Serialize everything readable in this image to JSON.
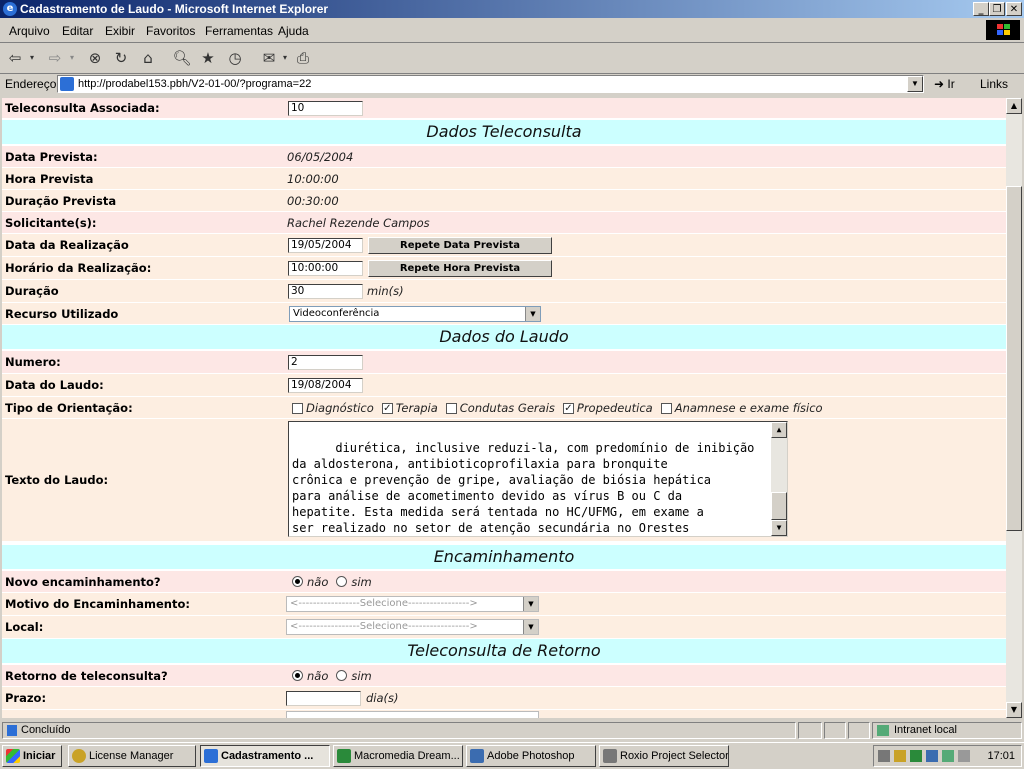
{
  "window": {
    "title": "Cadastramento de Laudo - Microsoft Internet Explorer"
  },
  "menu": [
    "Arquivo",
    "Editar",
    "Exibir",
    "Favoritos",
    "Ferramentas",
    "Ajuda"
  ],
  "address": {
    "label": "Endereço",
    "url": "http://prodabel153.pbh/V2-01-00/?programa=22",
    "go": "Ir",
    "links": "Links"
  },
  "form": {
    "teleconsulta_associada": {
      "label": "Teleconsulta Associada:",
      "value": "10"
    },
    "section_teleconsulta": "Dados Teleconsulta",
    "data_prevista": {
      "label": "Data Prevista:",
      "value": "06/05/2004"
    },
    "hora_prevista": {
      "label": "Hora Prevista",
      "value": "10:00:00"
    },
    "duracao_prevista": {
      "label": "Duração Prevista",
      "value": "00:30:00"
    },
    "solicitantes": {
      "label": "Solicitante(s):",
      "value": "Rachel Rezende Campos"
    },
    "data_realizacao": {
      "label": "Data da Realização",
      "value": "19/05/2004",
      "button": "Repete Data Prevista"
    },
    "horario_realizacao": {
      "label": "Horário da Realização:",
      "value": "10:00:00",
      "button": "Repete Hora Prevista"
    },
    "duracao": {
      "label": "Duração",
      "value": "30",
      "unit": "min(s)"
    },
    "recurso": {
      "label": "Recurso Utilizado",
      "value": "Videoconferência"
    },
    "section_laudo": "Dados do Laudo",
    "numero": {
      "label": "Numero:",
      "value": "2"
    },
    "data_laudo": {
      "label": "Data do Laudo:",
      "value": "19/08/2004"
    },
    "tipo_orientacao": {
      "label": "Tipo de Orientação:",
      "options": [
        {
          "label": "Diagnóstico",
          "checked": false
        },
        {
          "label": "Terapia",
          "checked": true
        },
        {
          "label": "Condutas Gerais",
          "checked": false
        },
        {
          "label": "Propedeutica",
          "checked": true
        },
        {
          "label": "Anamnese e exame físico",
          "checked": false
        }
      ]
    },
    "texto_laudo": {
      "label": "Texto do Laudo:",
      "value": "diurética, inclusive reduzi-la, com predomínio de inibição\nda aldosterona, antibioticoprofilaxia para bronquite\ncrônica e prevenção de gripe, avaliação de biósia hepática\npara análise de acometimento devido as vírus B ou C da\nhepatite. Esta medida será tentada no HC/UFMG, em exame a\nser realizado no setor de atenção secundária no Orestes\nDiniz."
    },
    "section_encaminhamento": "Encaminhamento",
    "novo_encaminhamento": {
      "label": "Novo encaminhamento?",
      "no": "não",
      "yes": "sim",
      "selected": "não"
    },
    "motivo_encaminhamento": {
      "label": "Motivo do Encaminhamento:",
      "value": "<-----------------Selecione----------------->"
    },
    "local": {
      "label": "Local:",
      "value": "<-----------------Selecione----------------->"
    },
    "section_retorno": "Teleconsulta de Retorno",
    "retorno": {
      "label": "Retorno de teleconsulta?",
      "no": "não",
      "yes": "sim",
      "selected": "não"
    },
    "prazo": {
      "label": "Prazo:",
      "value": "",
      "unit": "dia(s)"
    }
  },
  "status": {
    "text": "Concluído",
    "zone": "Intranet local"
  },
  "taskbar": {
    "start": "Iniciar",
    "tasks": [
      "License Manager",
      "Cadastramento ...",
      "Macromedia Dream...",
      "Adobe Photoshop",
      "Roxio Project Selector"
    ],
    "clock": "17:01"
  }
}
